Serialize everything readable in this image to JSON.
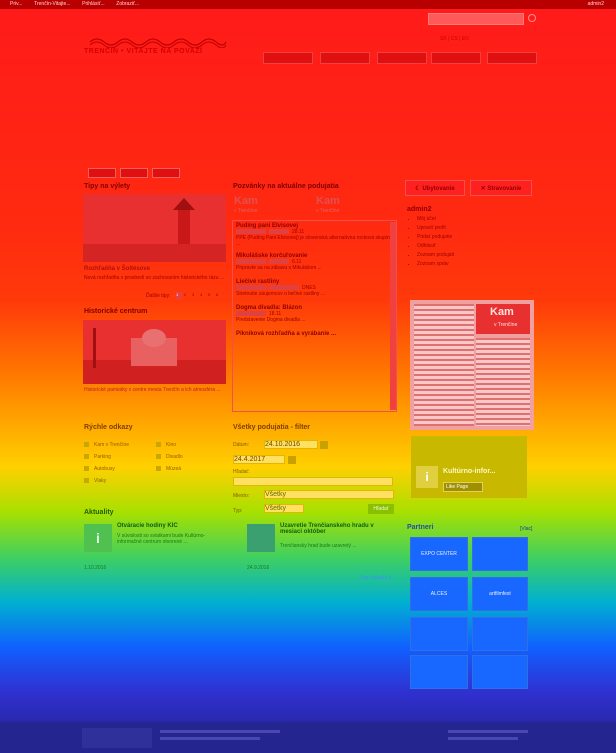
{
  "toolbar": {
    "items": [
      "Priv...",
      "Trenčín-Vitajte...",
      "Prihlásiť...",
      "Zobraziť..."
    ],
    "right": [
      "admin2"
    ]
  },
  "site": {
    "title": "TRENČÍN • VITAJTE NA POVAŽÍ"
  },
  "lang": {
    "label": "SK | CS | EN"
  },
  "main_menu": [
    "",
    "",
    "",
    "",
    ""
  ],
  "tips": {
    "title": "Tipy na výlety",
    "place_title": "Rozhľadňa v Šoltésove",
    "place_text": "Nová rozhľadňa v prostredí so zachovaním historického rázu ...",
    "pagination_label": "Ďalšie tipy:",
    "pages": [
      "1",
      "2",
      "3",
      "4",
      "5",
      "6"
    ]
  },
  "history": {
    "title": "Historické centrum",
    "text": "Historické pamiatky v centre mesta Trenčín a ich atmosféra ..."
  },
  "events": {
    "title": "Pozvánky na aktuálne podujatia",
    "kam1": "Kam",
    "kam1_sub": "v Trenčíne",
    "kam2": "Kam",
    "kam2_sub": "v Trenčíne",
    "items": [
      {
        "title": "Puding pani Elvisovej",
        "date": "28.11",
        "text": "PPE (Puding Pani Elvisovej) je slovenská alternatívna rocková skupina ..."
      },
      {
        "title": "Mikulášske korčuľovanie",
        "date": "6.11",
        "text": "Pripravte sa na zábavu s Mikulášom ..."
      },
      {
        "title": "Liečivé rastliny",
        "date": "DNES",
        "text": "Stretnutie záujemcov o liečivé rastliny ..."
      },
      {
        "title": "Dogma divadla: Blázon",
        "date": "18.11",
        "text": "Predstavenie Dogma divadla ..."
      },
      {
        "title": "Pikniková rozhľadňa a vyrábanie ...",
        "date": "",
        "text": ""
      }
    ]
  },
  "quicklinks": {
    "title": "Rýchle odkazy",
    "items": [
      "Kam v Trenčíne",
      "Parking",
      "Autobusy",
      "Vlaky",
      "Kino",
      "Divadlo",
      "Múzeá"
    ]
  },
  "filter": {
    "title": "Všetky podujatia - filter",
    "from_label": "Dátum:",
    "from_value": "24.10.2016",
    "to_value": "24.4.2017",
    "text_label": "Hľadať:",
    "place_label": "Miesto:",
    "place_value": "Všetky",
    "type_label": "Typ:",
    "type_value": "Všetky",
    "submit": "Hľadať"
  },
  "news": {
    "title": "Aktuality",
    "items": [
      {
        "title": "Otváracie hodiny KIC",
        "text": "V súvislosti so sviatkami bude Kultúrno-informačné centrum otvorené ...",
        "date": "1.10.2016"
      },
      {
        "title": "Uzavretie Trenčianskeho hradu v mesiaci október",
        "text": "Trenčiansky hrad bude uzavretý ...",
        "date": "24.9.2016"
      }
    ],
    "more": "Viac aktualít »"
  },
  "sidebar": {
    "ubytovanie": "Ubytovanie",
    "stravovanie": "Stravovanie",
    "user": "admin2",
    "user_links": [
      "Môj účet",
      "Upraviť profil",
      "Pridať podujatie",
      "Odhlásiť",
      "Zoznam podujatí",
      "Zoznam správ"
    ],
    "promo_title": "Kam",
    "promo_sub": "v Trenčíne",
    "fb_title": "Kultúrno-infor...",
    "fb_like": "Like Page",
    "partners_title": "Partneri",
    "partners_more": "[Viac]",
    "partners": [
      "EXPO CENTER",
      "",
      "",
      "ALCES",
      "artfilmfest",
      "",
      "",
      "",
      "",
      ""
    ]
  },
  "colors": {
    "accent": "#d80000",
    "wp_bar": "#b80000"
  }
}
